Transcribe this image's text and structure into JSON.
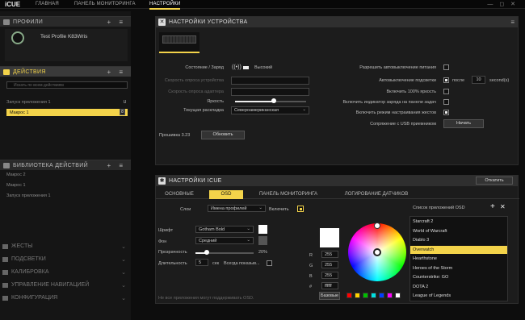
{
  "app": {
    "name": "iCUE"
  },
  "nav": {
    "home": "ГЛАВНАЯ",
    "monitoring": "ПАНЕЛЬ МОНИТОРИНГА",
    "settings": "НАСТРОЙКИ"
  },
  "left": {
    "profiles": {
      "title": "ПРОФИЛИ",
      "controls": "+ ≡",
      "profile_name": "Test Profile K83Wris"
    },
    "actions": {
      "title": "ДЕЙСТВИЯ",
      "controls": "+ ≡",
      "search_placeholder": "Искать по всем действиям",
      "items": [
        {
          "label": "Запуск приложения 1",
          "key": "U"
        },
        {
          "label": "Макрос 1",
          "key": "8"
        }
      ]
    },
    "library": {
      "title": "БИБЛИОТЕКА ДЕЙСТВИЙ",
      "controls": "+ ≡",
      "items": [
        "Макрос 2",
        "Макрос 1",
        "Запуск приложения 1"
      ]
    },
    "collapsed": [
      "ЖЕСТЫ",
      "ПОДСВЕТКИ",
      "КАЛИБРОВКА",
      "УПРАВЛЕНИЕ НАВИГАЦИЕЙ",
      "КОНФИГУРАЦИЯ"
    ]
  },
  "device": {
    "title": "НАСТРОЙКИ УСТРОЙСТВА",
    "status_label": "Состояние / Заряд",
    "status_value": "Высокий",
    "poll_device": "Скорость опроса устройства",
    "poll_adapter": "Скорость опроса адаптера",
    "brightness": "Яркость",
    "brightness_level": 0.55,
    "layout_label": "Текущая раскладка",
    "layout_value": "Североамериканская",
    "firmware": "Прошивка 3.23",
    "update_btn": "Обновить",
    "opt_auto_power": "Разрешить автовыключение питания",
    "opt_auto_light": "Автовыключение подсветки",
    "after": "после",
    "seconds_value": "10",
    "seconds_unit": "second(s)",
    "opt_full_bright": "Включить 100% яркость",
    "opt_charge": "Включить индикатор заряда на панели задач",
    "opt_gesture": "Включить режим настраивания жестов",
    "usb_pair": "Сопряжение с USB приемником",
    "start_btn": "Начать"
  },
  "icue": {
    "title": "НАСТРОЙКИ ICUE",
    "rollback": "Откатить",
    "tabs": [
      "ОСНОВНЫЕ",
      "OSD",
      "ПАНЕЛЬ МОНИТОРИНГА",
      "ЛОГИРОВАНИЕ ДАТЧИКОВ"
    ],
    "layers_label": "Слои",
    "layers_value": "Имена профилей",
    "enable_label": "Включить",
    "font_label": "Шрифт",
    "font_value": "Gotham Bold",
    "bg_label": "Фон",
    "bg_value": "Средний",
    "transparency_label": "Прозрачность",
    "transparency_value": "20%",
    "transparency_level": 0.2,
    "duration_label": "Длительность",
    "duration_value": "5",
    "duration_unit": "сек",
    "always_show": "Всегда показыв...",
    "note": "Не все приложения могут поддерживать OSD.",
    "r_label": "R",
    "g_label": "G",
    "b_label": "B",
    "hash_label": "#",
    "r": "255",
    "g": "255",
    "b": "255",
    "hex": "ffffff",
    "base_btn": "Базовые",
    "swatches": [
      "#ff0000",
      "#ffd200",
      "#00c000",
      "#00e0e0",
      "#0040ff",
      "#ff00ff",
      "#ffffff"
    ],
    "apps_title": "Список приложений OSD",
    "apps": [
      "Starcraft 2",
      "World of Warcraft",
      "Diablo 3",
      "Overwatch",
      "Hearthstone",
      "Heroes of the Storm",
      "Counterstrike: GO",
      "DOTA 2",
      "League of Legends"
    ],
    "selected_app": 3
  },
  "colors": {
    "accent": "#f3d34a"
  }
}
